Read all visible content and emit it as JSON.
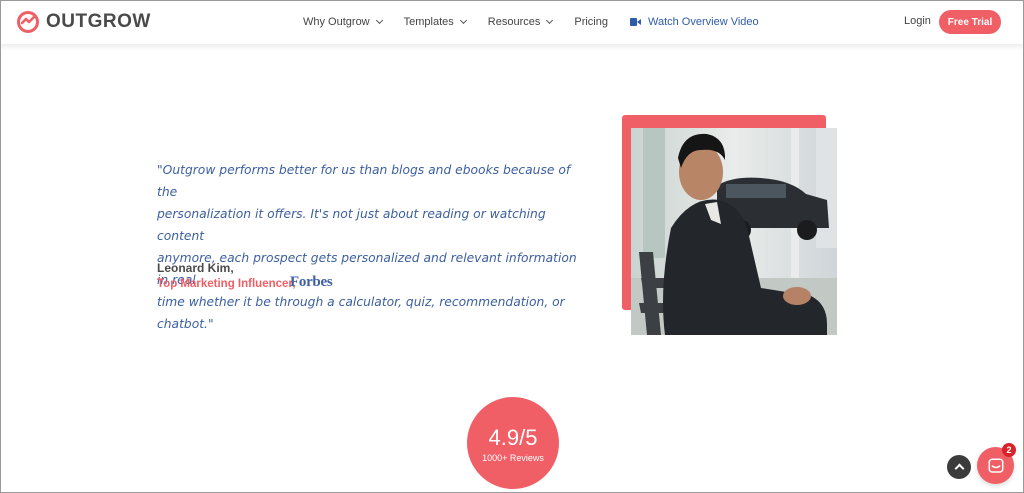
{
  "brand": {
    "name": "OUTGROW",
    "accent": "#f05f66",
    "link_blue": "#2f5ca8"
  },
  "nav": {
    "items": [
      {
        "label": "Why Outgrow",
        "has_dropdown": true
      },
      {
        "label": "Templates",
        "has_dropdown": true
      },
      {
        "label": "Resources",
        "has_dropdown": true
      },
      {
        "label": "Pricing",
        "has_dropdown": false
      }
    ],
    "video_label": "Watch Overview Video",
    "login_label": "Login",
    "trial_label": "Free Trial"
  },
  "testimonial": {
    "quote_lines": [
      "\"Outgrow performs better for us than blogs and ebooks because of the",
      "personalization it offers. It's not just about reading or watching content",
      "anymore, each prospect gets personalized and relevant information in real",
      "time whether it be through a calculator, quiz, recommendation, or chatbot.\""
    ],
    "author_name": "Leonard Kim,",
    "author_role": "Top Marketing Influencer,",
    "publication": "Forbes"
  },
  "rating": {
    "score": "4.9/5",
    "subtitle": "1000+ Reviews"
  },
  "chat": {
    "badge_count": "2"
  }
}
